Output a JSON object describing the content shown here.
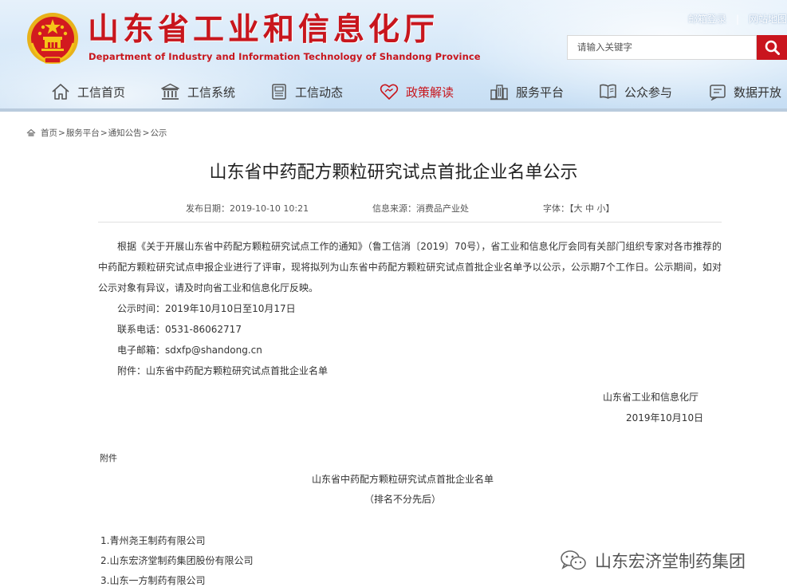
{
  "header": {
    "title": "山东省工业和信息化厅",
    "subtitle": "Department of Industry and Information Technology of Shandong Province",
    "links": [
      "邮箱登录",
      "网站地图"
    ],
    "link_separator": "|",
    "search_placeholder": "请输入关键字"
  },
  "nav": [
    {
      "label": "工信首页",
      "icon": "home-icon"
    },
    {
      "label": "工信系统",
      "icon": "building-icon"
    },
    {
      "label": "工信动态",
      "icon": "document-icon"
    },
    {
      "label": "政策解读",
      "icon": "heart-handshake-icon"
    },
    {
      "label": "服务平台",
      "icon": "city-icon"
    },
    {
      "label": "公众参与",
      "icon": "book-icon"
    },
    {
      "label": "数据开放",
      "icon": "data-icon"
    }
  ],
  "breadcrumb": [
    "首页",
    "服务平台",
    "通知公告",
    "公示"
  ],
  "breadcrumb_sep": ">",
  "article": {
    "title": "山东省中药配方颗粒研究试点首批企业名单公示",
    "publish_date": "发布日期：2019-10-10 10:21",
    "source": "信息来源：消费品产业处",
    "font_size_label": "字体：",
    "font_size_options": [
      "【大",
      "中",
      "小】"
    ],
    "body": "根据《关于开展山东省中药配方颗粒研究试点工作的通知》（鲁工信消〔2019〕70号），省工业和信息化厅会同有关部门组织专家对各市推荐的中药配方颗粒研究试点申报企业进行了评审，现将拟列为山东省中药配方颗粒研究试点首批企业名单予以公示，公示期7个工作日。公示期间，如对公示对象有异议，请及时向省工业和信息化厅反映。",
    "period": "公示时间：2019年10月10日至10月17日",
    "phone": "联系电话：0531-86062717",
    "email": "电子邮箱：sdxfp@shandong.cn",
    "attachment": "附件：山东省中药配方颗粒研究试点首批企业名单",
    "signature_org": "山东省工业和信息化厅",
    "signature_date": "2019年10月10日"
  },
  "attachment_doc": {
    "label": "附件",
    "title": "山东省中药配方颗粒研究试点首批企业名单",
    "note": "（排名不分先后）",
    "companies": [
      "1.青州尧王制药有限公司",
      "2.山东宏济堂制药集团股份有限公司",
      "3.山东一方制药有限公司"
    ]
  },
  "watermark": "山东宏济堂制药集团",
  "colors": {
    "brand_red": "#c8161d",
    "header_bg": "#d4e7f8",
    "text": "#333333"
  }
}
